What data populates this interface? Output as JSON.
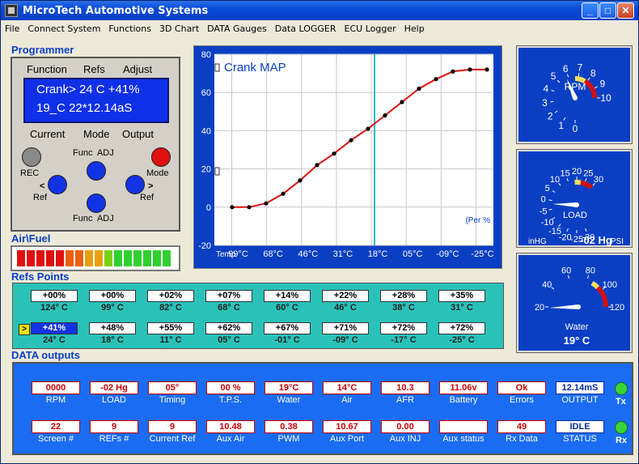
{
  "window": {
    "title": "MicroTech Automotive Systems",
    "min": "_",
    "max": "□",
    "close": "✕"
  },
  "menu": [
    "File",
    "Connect System",
    "Functions",
    "3D Chart",
    "DATA Gauges",
    "Data LOGGER",
    "ECU Logger",
    "Help"
  ],
  "programmer": {
    "section_label": "Programmer",
    "headers": [
      "Function",
      "Refs",
      "Adjust"
    ],
    "lcd_line1": "Crank> 24 C +41%",
    "lcd_line2": "19_C 22*12.14aS",
    "row_labels": [
      "Current",
      "Mode",
      "Output"
    ],
    "buttons": {
      "func_adj_top": "Func  ADJ",
      "rec": "REC",
      "mode": "Mode",
      "ref_left": "Ref",
      "ref_right": "Ref",
      "func_adj_bottom": "Func  ADJ",
      "arrow_left": "<",
      "arrow_right": ">"
    }
  },
  "airfuel": {
    "label": "Air\\Fuel",
    "segments": [
      "#e01010",
      "#e01010",
      "#e01010",
      "#e01010",
      "#e01010",
      "#e86010",
      "#e86010",
      "#e8a010",
      "#e8a010",
      "#7ad010",
      "#30d030",
      "#30d030",
      "#30d030",
      "#30d030",
      "#30d030",
      "#30d030"
    ]
  },
  "chart_data": {
    "type": "line",
    "title": "Crank MAP",
    "note": "(Per %",
    "x_prefix": "Temp",
    "x": [
      "99°C",
      "68°C",
      "46°C",
      "31°C",
      "18°C",
      "05°C",
      "-09°C",
      "-25°C"
    ],
    "y_ticks": [
      "80",
      "60",
      "40",
      "20",
      "0",
      "-20"
    ],
    "ylim": [
      -20,
      80
    ],
    "series": [
      {
        "values": [
          0,
          0,
          2,
          7,
          14,
          22,
          28,
          35,
          41,
          48,
          55,
          62,
          67,
          71,
          72,
          72
        ]
      }
    ],
    "cursor_index": 8,
    "colors": {
      "bg": "#ffffff",
      "line": "#e01010",
      "cursor": "#20c0c0",
      "text": "#0a3fc4"
    }
  },
  "refs": {
    "label": "Refs Points",
    "row1": [
      {
        "v": "+00%",
        "t": "124° C"
      },
      {
        "v": "+00%",
        "t": "99° C"
      },
      {
        "v": "+02%",
        "t": "82° C"
      },
      {
        "v": "+07%",
        "t": "68° C"
      },
      {
        "v": "+14%",
        "t": "60° C"
      },
      {
        "v": "+22%",
        "t": "46° C"
      },
      {
        "v": "+28%",
        "t": "38° C"
      },
      {
        "v": "+35%",
        "t": "31° C"
      }
    ],
    "row2": [
      {
        "v": "+41%",
        "t": "24° C"
      },
      {
        "v": "+48%",
        "t": "18° C"
      },
      {
        "v": "+55%",
        "t": "11° C"
      },
      {
        "v": "+62%",
        "t": "05° C"
      },
      {
        "v": "+67%",
        "t": "-01° C"
      },
      {
        "v": "+71%",
        "t": "-09° C"
      },
      {
        "v": "+72%",
        "t": "-17° C"
      },
      {
        "v": "+72%",
        "t": "-25° C"
      }
    ],
    "cursor": ">"
  },
  "gauges": {
    "rpm": {
      "label": "RPM",
      "ticks": [
        "0",
        "1",
        "2",
        "3",
        "4",
        "5",
        "6",
        "7",
        "8",
        "9",
        "10"
      ],
      "value": 5.8
    },
    "load": {
      "label": "LOAD",
      "ticks": [
        "-30",
        "-25",
        "-20",
        "-15",
        "-10",
        "-5",
        "0",
        "5",
        "10",
        "15",
        "20",
        "25",
        "30"
      ],
      "readout": "-02 Hg",
      "left": "inHG",
      "right": "PSI",
      "value": -2
    },
    "water": {
      "label": "Water",
      "ticks": [
        "20",
        "40",
        "60",
        "80",
        "100",
        "120"
      ],
      "readout": "19° C",
      "value": 19
    }
  },
  "data_outputs": {
    "label": "DATA outputs",
    "row1": [
      {
        "v": "0000",
        "l": "RPM"
      },
      {
        "v": "-02 Hg",
        "l": "LOAD"
      },
      {
        "v": "05°",
        "l": "Timing"
      },
      {
        "v": "00 %",
        "l": "T.P.S."
      },
      {
        "v": "19°C",
        "l": "Water"
      },
      {
        "v": "14°C",
        "l": "Air"
      },
      {
        "v": "10.3",
        "l": "AFR"
      },
      {
        "v": "11.06v",
        "l": "Battery"
      },
      {
        "v": "Ok",
        "l": "Errors"
      },
      {
        "v": "12.14mS",
        "l": "OUTPUT"
      }
    ],
    "row2": [
      {
        "v": "22",
        "l": "Screen #"
      },
      {
        "v": "9",
        "l": "REFs #"
      },
      {
        "v": "9",
        "l": "Current Ref"
      },
      {
        "v": "10.48",
        "l": "Aux Air"
      },
      {
        "v": "0.38",
        "l": "PWM"
      },
      {
        "v": "10.67",
        "l": "Aux Port"
      },
      {
        "v": "0.00",
        "l": "Aux INJ"
      },
      {
        "v": "",
        "l": "Aux status"
      },
      {
        "v": "49",
        "l": "Rx Data"
      },
      {
        "v": "IDLE",
        "l": "STATUS"
      }
    ],
    "tx": "Tx",
    "rx": "Rx"
  }
}
